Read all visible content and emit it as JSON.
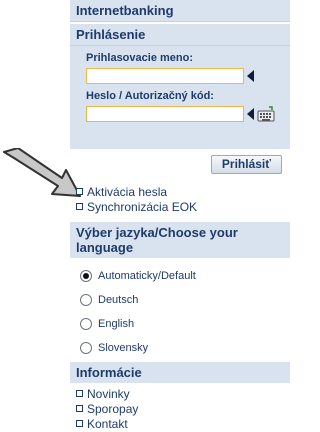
{
  "header": {
    "title": "Internetbanking"
  },
  "login": {
    "section_title": "Prihlásenie",
    "username_label": "Prihlasovacie meno:",
    "username_value": "",
    "password_label": "Heslo / Autorizačný kód:",
    "password_value": "",
    "submit_label": "Prihlásiť"
  },
  "login_links": [
    {
      "label": "Aktivácia hesla"
    },
    {
      "label": "Synchronizácia EOK"
    }
  ],
  "language": {
    "title": "Výber jazyka/Choose your language",
    "options": [
      {
        "label": "Automaticky/Default",
        "selected": true
      },
      {
        "label": "Deutsch",
        "selected": false
      },
      {
        "label": "English",
        "selected": false
      },
      {
        "label": "Slovensky",
        "selected": false
      }
    ]
  },
  "info": {
    "title": "Informácie",
    "links": [
      {
        "label": "Novinky"
      },
      {
        "label": "Sporopay"
      },
      {
        "label": "Kontakt"
      }
    ]
  },
  "icons": {
    "field_pointer": "left-triangle-icon",
    "virtual_keyboard": "keyboard-icon",
    "annotation": "arrow-icon"
  },
  "colors": {
    "section_bg": "#d9e3ef",
    "text": "#1f3b6a",
    "input_border": "#f0b64a"
  }
}
